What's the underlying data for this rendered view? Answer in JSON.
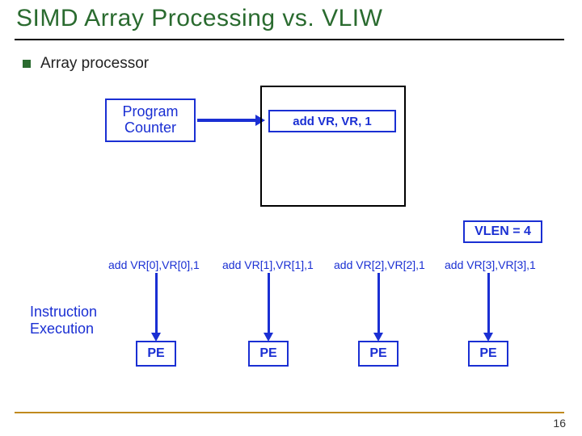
{
  "title": "SIMD Array Processing vs. VLIW",
  "bullet": "Array processor",
  "diagram": {
    "program_counter": "Program\nCounter",
    "instruction": "add  VR, VR, 1",
    "vlen": "VLEN = 4",
    "instruction_execution": "Instruction\nExecution",
    "lanes": [
      {
        "label": "add VR[0],VR[0],1",
        "pe": "PE"
      },
      {
        "label": "add VR[1],VR[1],1",
        "pe": "PE"
      },
      {
        "label": "add VR[2],VR[2],1",
        "pe": "PE"
      },
      {
        "label": "add VR[3],VR[3],1",
        "pe": "PE"
      }
    ]
  },
  "page_number": "16"
}
